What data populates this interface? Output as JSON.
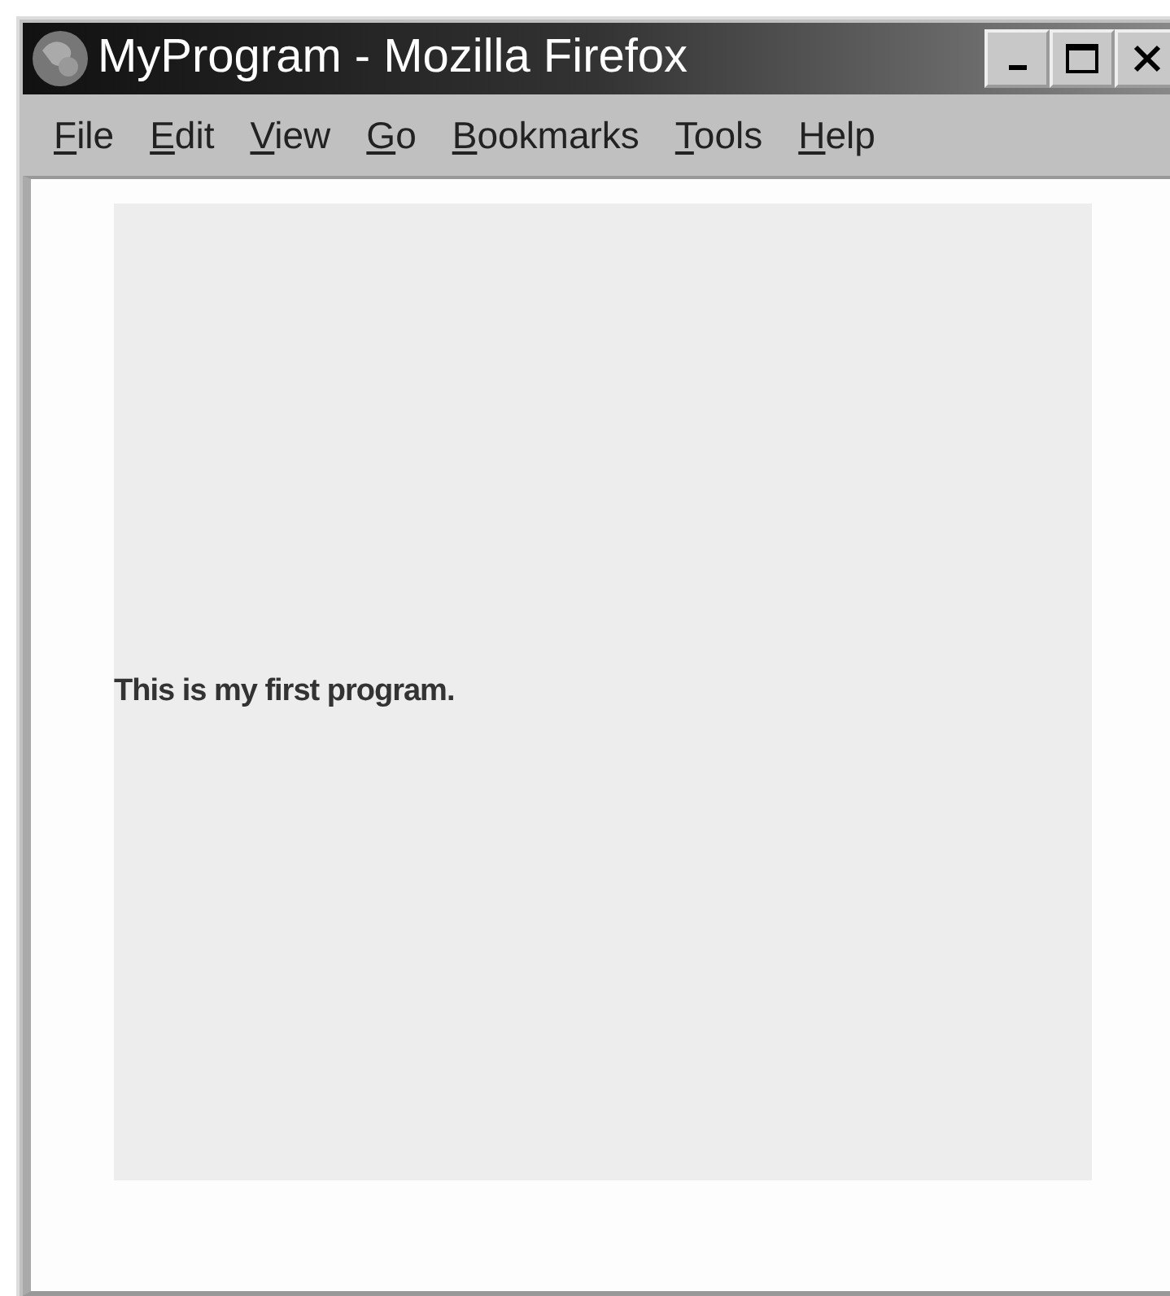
{
  "window": {
    "title": "MyProgram - Mozilla Firefox"
  },
  "menu": [
    {
      "mnemonic": "F",
      "rest": "ile"
    },
    {
      "mnemonic": "E",
      "rest": "dit"
    },
    {
      "mnemonic": "V",
      "rest": "iew"
    },
    {
      "mnemonic": "G",
      "rest": "o"
    },
    {
      "mnemonic": "B",
      "rest": "ookmarks"
    },
    {
      "mnemonic": "T",
      "rest": "ools"
    },
    {
      "mnemonic": "H",
      "rest": "elp"
    }
  ],
  "content": {
    "text": "This is my first program."
  }
}
